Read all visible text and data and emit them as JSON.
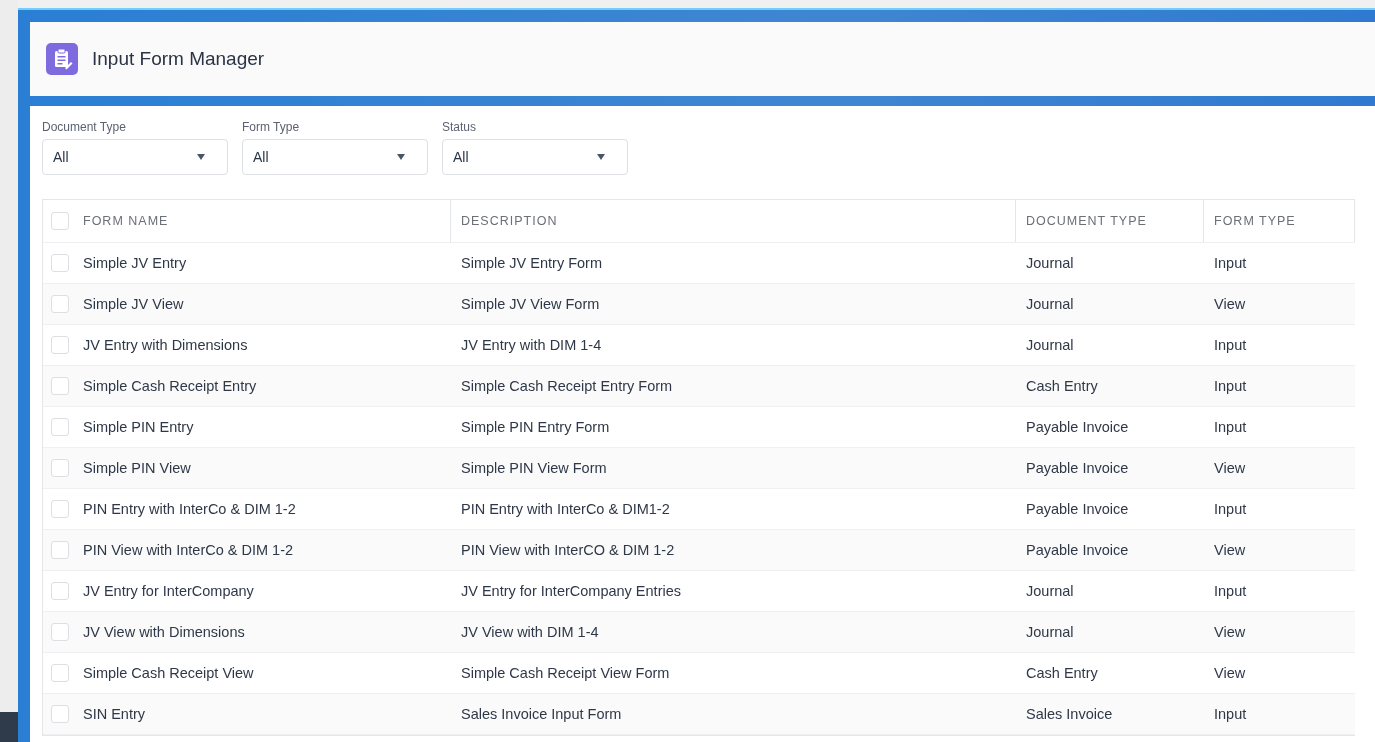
{
  "header": {
    "title": "Input Form Manager"
  },
  "filters": [
    {
      "label": "Document Type",
      "value": "All"
    },
    {
      "label": "Form Type",
      "value": "All"
    },
    {
      "label": "Status",
      "value": "All"
    }
  ],
  "table": {
    "all_checked": false,
    "columns": [
      "FORM NAME",
      "DESCRIPTION",
      "DOCUMENT TYPE",
      "FORM TYPE"
    ],
    "rows": [
      {
        "checked": false,
        "cells": [
          "Simple JV Entry",
          "Simple JV Entry Form",
          "Journal",
          "Input"
        ]
      },
      {
        "checked": false,
        "cells": [
          "Simple JV View",
          "Simple JV View Form",
          "Journal",
          "View"
        ]
      },
      {
        "checked": false,
        "cells": [
          "JV Entry with Dimensions",
          "JV Entry with DIM 1-4",
          "Journal",
          "Input"
        ]
      },
      {
        "checked": false,
        "cells": [
          "Simple Cash Receipt Entry",
          "Simple Cash Receipt Entry Form",
          "Cash Entry",
          "Input"
        ]
      },
      {
        "checked": false,
        "cells": [
          "Simple PIN Entry",
          "Simple PIN Entry Form",
          "Payable Invoice",
          "Input"
        ]
      },
      {
        "checked": false,
        "cells": [
          "Simple PIN View",
          "Simple PIN View Form",
          "Payable Invoice",
          "View"
        ]
      },
      {
        "checked": false,
        "cells": [
          "PIN Entry with InterCo & DIM 1-2",
          "PIN Entry with InterCo & DIM1-2",
          "Payable Invoice",
          "Input"
        ]
      },
      {
        "checked": false,
        "cells": [
          "PIN View with InterCo & DIM 1-2",
          "PIN View with InterCO & DIM 1-2",
          "Payable Invoice",
          "View"
        ]
      },
      {
        "checked": false,
        "cells": [
          "JV Entry for InterCompany",
          "JV Entry for InterCompany Entries",
          "Journal",
          "Input"
        ]
      },
      {
        "checked": false,
        "cells": [
          "JV View with Dimensions",
          "JV View with DIM 1-4",
          "Journal",
          "View"
        ]
      },
      {
        "checked": false,
        "cells": [
          "Simple Cash Receipt View",
          "Simple Cash Receipt View Form",
          "Cash Entry",
          "View"
        ]
      },
      {
        "checked": false,
        "cells": [
          "SIN Entry",
          "Sales Invoice Input Form",
          "Sales Invoice",
          "Input"
        ]
      }
    ]
  }
}
